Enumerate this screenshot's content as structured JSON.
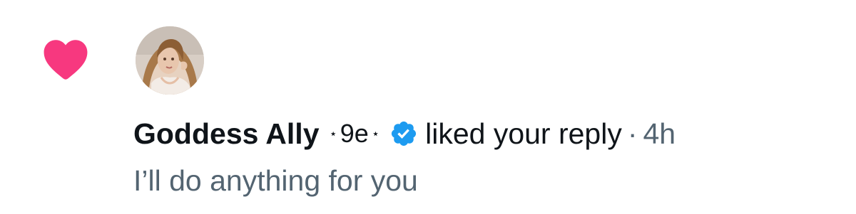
{
  "notification": {
    "type_icon": "heart-icon",
    "avatar_icon": "user-avatar",
    "user": {
      "display_name": "Goddess Ally",
      "name_decoration": "9e",
      "decoration_star": "⋆",
      "verified_icon": "verified-badge-icon"
    },
    "action": "liked your reply",
    "separator": "·",
    "time": "4h",
    "reply_text": "I’ll do anything for you"
  },
  "colors": {
    "heart": "#f91880",
    "verified_badge": "#1d9bf0",
    "primary_text": "#0f1419",
    "secondary_text": "#536471",
    "background": "#ffffff"
  }
}
